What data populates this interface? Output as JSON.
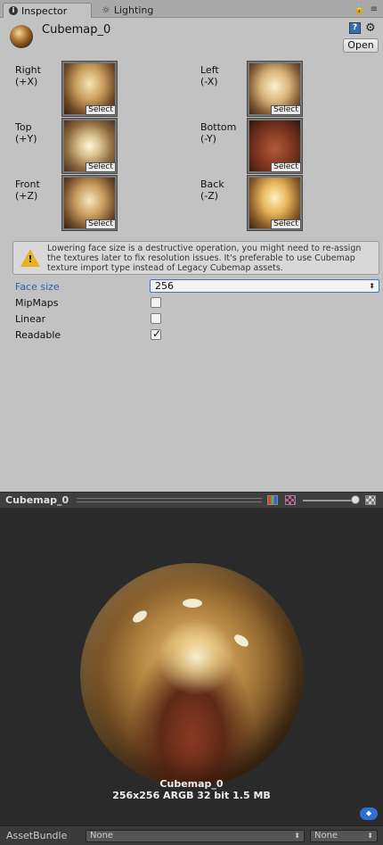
{
  "tabs": {
    "inspector": "Inspector",
    "lighting": "Lighting"
  },
  "header": {
    "title": "Cubemap_0",
    "open_button": "Open"
  },
  "faces": [
    {
      "name": "Right",
      "axis": "(+X)",
      "select": "Select"
    },
    {
      "name": "Left",
      "axis": "(-X)",
      "select": "Select"
    },
    {
      "name": "Top",
      "axis": "(+Y)",
      "select": "Select"
    },
    {
      "name": "Bottom",
      "axis": "(-Y)",
      "select": "Select"
    },
    {
      "name": "Front",
      "axis": "(+Z)",
      "select": "Select"
    },
    {
      "name": "Back",
      "axis": "(-Z)",
      "select": "Select"
    }
  ],
  "warning": "Lowering face size is a destructive operation, you might need to re-assign the textures later to fix resolution issues. It's preferable to use Cubemap texture import type instead of Legacy Cubemap assets.",
  "properties": {
    "face_size_label": "Face size",
    "face_size_value": "256",
    "mipmaps_label": "MipMaps",
    "mipmaps_checked": false,
    "linear_label": "Linear",
    "linear_checked": false,
    "readable_label": "Readable",
    "readable_checked": true
  },
  "preview": {
    "title": "Cubemap_0",
    "info_name": "Cubemap_0",
    "info_details": "256x256  ARGB 32 bit  1.5 MB"
  },
  "asset_bundle": {
    "label": "AssetBundle",
    "bundle_value": "None",
    "variant_value": "None"
  },
  "colors": {
    "accent_blue": "#2d5fb4",
    "warning_yellow": "#e8b21c",
    "panel_gray": "#c2c2c2",
    "preview_dark": "#2a2a2a"
  }
}
